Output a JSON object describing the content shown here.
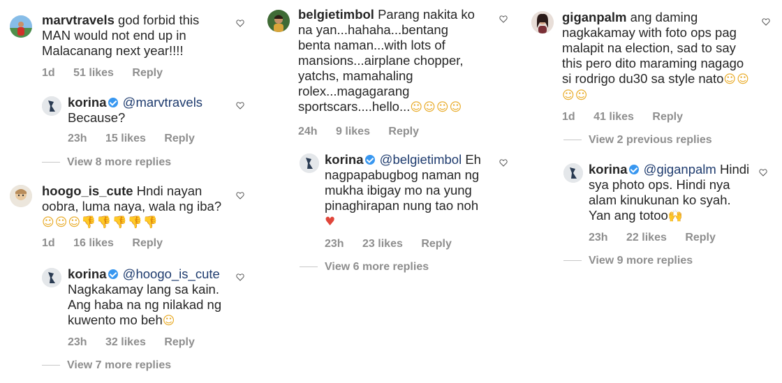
{
  "columns": [
    {
      "threads": [
        {
          "comment": {
            "username": "marvtravels",
            "text": "god forbid this MAN would not end up in Malacanang next year!!!!",
            "time": "1d",
            "likes": "51 likes",
            "reply": "Reply"
          },
          "reply": {
            "username": "korina",
            "mention": "@marvtravels",
            "text": "Because?",
            "time": "23h",
            "likes": "15 likes",
            "reply": "Reply"
          },
          "view_more": "View 8 more replies"
        },
        {
          "comment": {
            "username": "hoogo_is_cute",
            "text": "Hndi nayan oobra, luma naya, wala ng iba?",
            "emoji": "☺☺☺",
            "emoji_hands": "👎👎👎👎👎",
            "time": "1d",
            "likes": "16 likes",
            "reply": "Reply"
          },
          "reply": {
            "username": "korina",
            "mention": "@hoogo_is_cute",
            "text": "Nagkakamay lang sa kain. Ang haba na ng nilakad ng kuwento mo beh",
            "emoji": "☺",
            "time": "23h",
            "likes": "32 likes",
            "reply": "Reply"
          },
          "view_more": "View 7 more replies"
        }
      ]
    },
    {
      "threads": [
        {
          "comment": {
            "username": "belgietimbol",
            "text": "Parang nakita ko na yan...hahaha...bentang benta naman...with lots of mansions...airplane chopper, yatchs, mamahaling rolex...magagarang sportscars....hello...",
            "emoji": "☺☺☺☺",
            "time": "24h",
            "likes": "9 likes",
            "reply": "Reply"
          },
          "reply": {
            "username": "korina",
            "mention": "@belgietimbol",
            "text": "Eh nagpapabugbog naman ng mukha ibigay mo na yung pinaghirapan nung tao noh",
            "emoji": "♥",
            "time": "23h",
            "likes": "23 likes",
            "reply": "Reply"
          },
          "view_more": "View 6 more replies"
        }
      ]
    },
    {
      "threads": [
        {
          "comment": {
            "username": "giganpalm",
            "text": "ang daming nagkakamay with foto ops pag malapit na election, sad to say this pero dito maraming nagago si rodrigo du30 sa style nato",
            "emoji": "☺☺☺☺",
            "time": "1d",
            "likes": "41 likes",
            "reply": "Reply"
          },
          "view_previous": "View 2 previous replies",
          "reply": {
            "username": "korina",
            "mention": "@giganpalm",
            "text": "Hindi sya photo ops. Hindi nya alam kinukunan ko syah. Yan ang totoo",
            "emoji": "🙌",
            "time": "23h",
            "likes": "22 likes",
            "reply": "Reply"
          },
          "view_more": "View 9 more replies"
        }
      ]
    }
  ],
  "colors": {
    "text": "#262626",
    "meta": "#8e8e8e",
    "mention": "#1e3b6e",
    "verified": "#3897f0",
    "emoji": "#e8a820"
  },
  "icons": {
    "like": "heart-outline-icon",
    "verified": "verified-badge-icon"
  }
}
